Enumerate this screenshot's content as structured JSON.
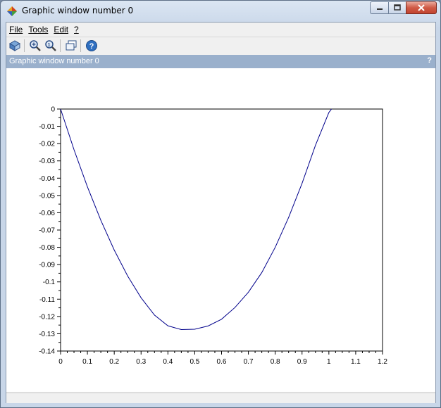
{
  "window": {
    "title": "Graphic window number 0",
    "icon": "scilab-app-icon",
    "controls": [
      "minimize-icon",
      "maximize-icon",
      "close-icon"
    ]
  },
  "menubar": {
    "items": [
      {
        "label": "File"
      },
      {
        "label": "Tools"
      },
      {
        "label": "Edit"
      },
      {
        "label": "?"
      }
    ]
  },
  "toolbar": {
    "buttons": [
      "rotate-icon",
      "zoom-icon",
      "zoom-reset-icon",
      "new-window-icon",
      "help-icon"
    ]
  },
  "panel": {
    "title": "Graphic window number 0",
    "help": "?"
  },
  "colors": {
    "curve": "#00008b",
    "panel_header": "#9ab0cc"
  },
  "chart_data": {
    "type": "line",
    "title": "",
    "xlabel": "",
    "ylabel": "",
    "xlim": [
      0,
      1.2
    ],
    "ylim": [
      -0.14,
      0
    ],
    "xticks": [
      "0",
      "0.1",
      "0.2",
      "0.3",
      "0.4",
      "0.5",
      "0.6",
      "0.7",
      "0.8",
      "0.9",
      "1",
      "1.1",
      "1.2"
    ],
    "yticks": [
      "0",
      "-0.01",
      "-0.02",
      "-0.03",
      "-0.04",
      "-0.05",
      "-0.06",
      "-0.07",
      "-0.08",
      "-0.09",
      "-0.1",
      "-0.11",
      "-0.12",
      "-0.13",
      "-0.14"
    ],
    "grid": false,
    "series": [
      {
        "x": [
          0,
          0.05,
          0.1,
          0.15,
          0.2,
          0.25,
          0.3,
          0.35,
          0.4,
          0.45,
          0.5,
          0.55,
          0.6,
          0.65,
          0.7,
          0.75,
          0.8,
          0.85,
          0.9,
          0.95,
          1.0,
          1.01
        ],
        "y": [
          0,
          -0.0235,
          -0.045,
          -0.0644,
          -0.0816,
          -0.0966,
          -0.1092,
          -0.1192,
          -0.1254,
          -0.1276,
          -0.1274,
          -0.1255,
          -0.1216,
          -0.1148,
          -0.106,
          -0.0946,
          -0.08,
          -0.0627,
          -0.043,
          -0.021,
          -0.002,
          0
        ]
      }
    ]
  }
}
